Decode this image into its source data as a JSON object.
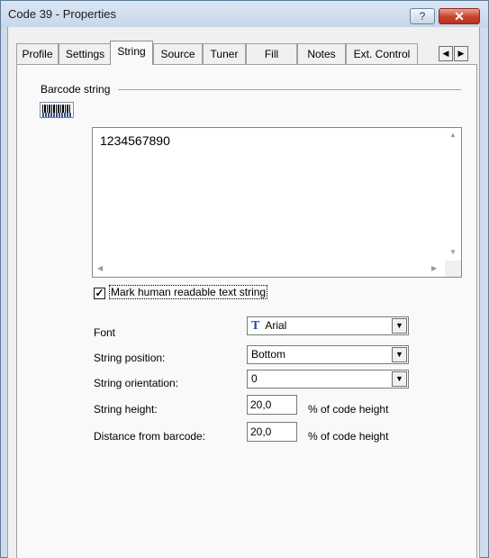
{
  "window": {
    "title": "Code 39 - Properties",
    "help_label": "?",
    "close_label": "✕"
  },
  "tabs": [
    {
      "label": "Profile"
    },
    {
      "label": "Settings"
    },
    {
      "label": "String",
      "active": true
    },
    {
      "label": "Source"
    },
    {
      "label": "Tuner"
    },
    {
      "label": "Fill"
    },
    {
      "label": "Notes"
    },
    {
      "label": "Ext. Control"
    }
  ],
  "tab_scroll": {
    "left": "◀",
    "right": "▶"
  },
  "group": {
    "label": "Barcode string"
  },
  "barcode_string": {
    "value": "1234567890"
  },
  "checkbox": {
    "label": "Mark human readable text string",
    "checked": true,
    "mark": "✓"
  },
  "form": {
    "font_label": "Font",
    "font_value": "Arial",
    "font_icon": "T",
    "position_label": "String position:",
    "position_value": "Bottom",
    "orientation_label": "String orientation:",
    "orientation_value": "0",
    "height_label": "String height:",
    "height_value": "20,0",
    "height_unit": "% of code height",
    "distance_label": "Distance from barcode:",
    "distance_value": "20,0",
    "distance_unit": "% of code height",
    "dropdown_arrow": "▼"
  },
  "colors": {
    "title_bar": "#c6d6ea",
    "close_button": "#c8422d",
    "font_icon": "#1f46b5"
  }
}
